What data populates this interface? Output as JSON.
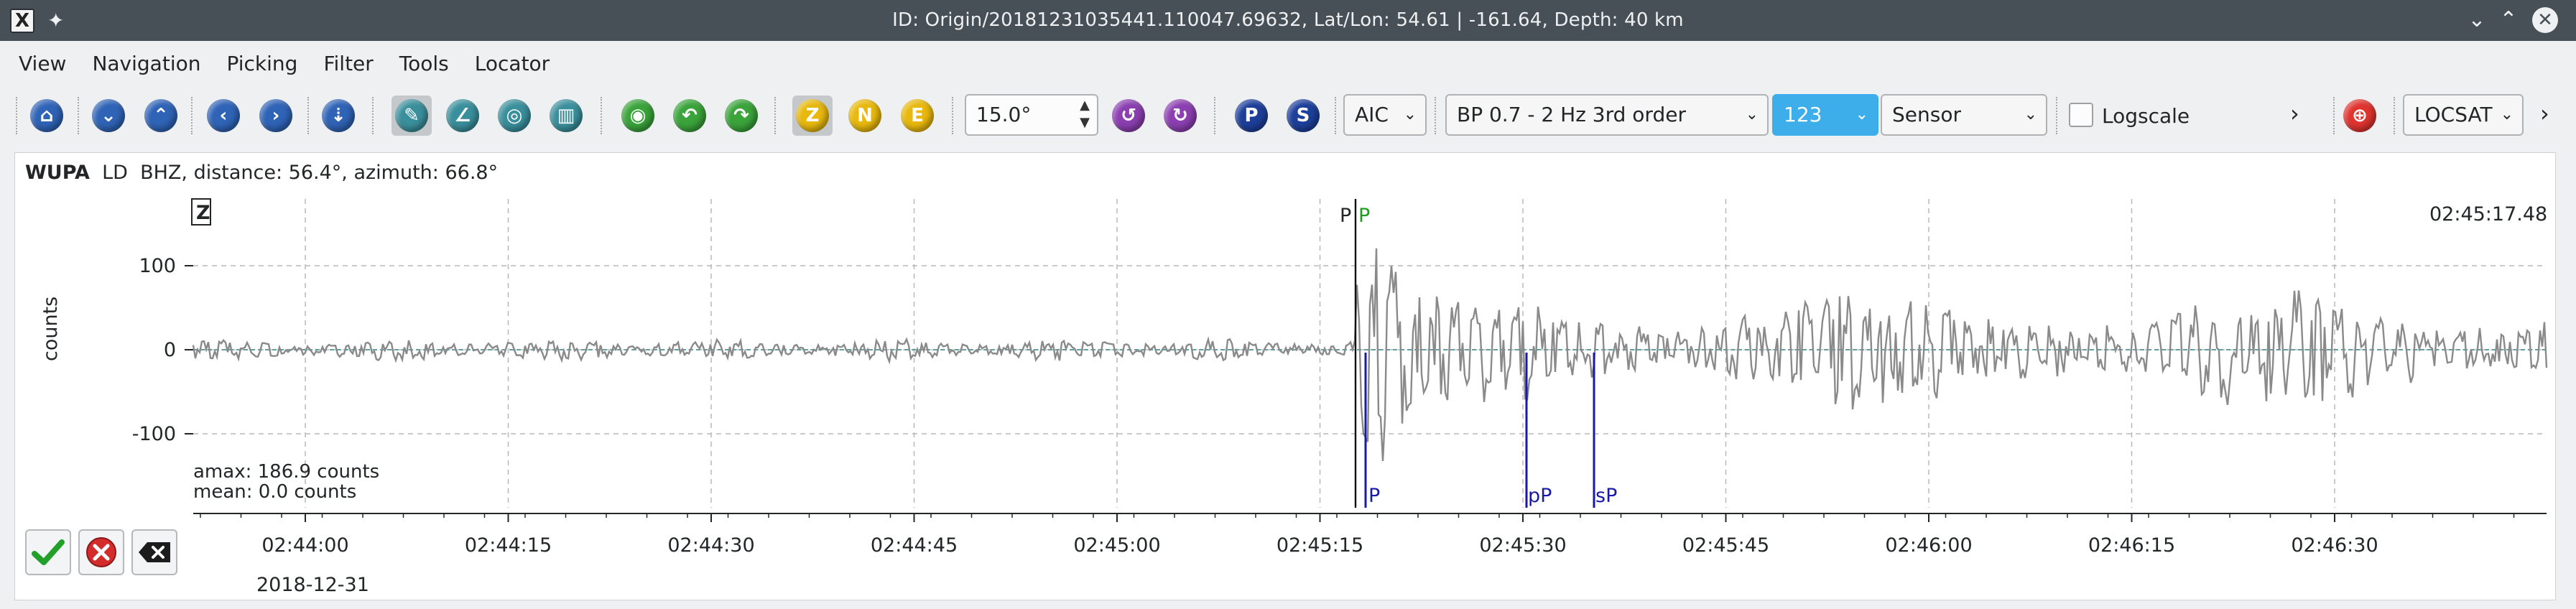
{
  "window": {
    "title": "ID: Origin/20181231035441.110047.69632, Lat/Lon: 54.61 | -161.64, Depth: 40 km",
    "app_icon": "x-app-icon",
    "pin_icon": "pin-icon"
  },
  "menu": {
    "items": [
      "View",
      "Navigation",
      "Picking",
      "Filter",
      "Tools",
      "Locator"
    ]
  },
  "toolbar": {
    "angle_value": "15.0°",
    "picker_method": "AIC",
    "filter": "BP 0.7 - 2 Hz  3rd order",
    "component_mode": "123",
    "unit": "Sensor",
    "logscale_label": "Logscale",
    "logscale_checked": false,
    "locator": "LOCSAT",
    "component_buttons": [
      "Z",
      "N",
      "E"
    ],
    "phase_buttons": [
      "P",
      "S"
    ],
    "colors": {
      "blue_button": "#2f63b6",
      "teal_button": "#3a8f9c",
      "green_button": "#3aa33a",
      "yellow_button": "#e8b80c",
      "purple_button": "#8b3fb0",
      "navy_button": "#1d3f9a",
      "red_target": "#e0342f"
    }
  },
  "trace": {
    "station": "WUPA",
    "network_channel": "LD  BHZ, distance: 56.4°, azimuth: 66.8°",
    "component_tag": "Z",
    "start_timestamp": "02:45:17.48",
    "ylabel": "counts",
    "amax": "amax: 186.9 counts",
    "mean": "mean: 0.0 counts",
    "date": "2018-12-31",
    "y_ticks": [
      "100",
      "0",
      "-100"
    ],
    "x_ticks": [
      "02:44:00",
      "02:44:15",
      "02:44:30",
      "02:44:45",
      "02:45:00",
      "02:45:15",
      "02:45:30",
      "02:45:45",
      "02:46:00",
      "02:46:15",
      "02:46:30"
    ],
    "picks_top": [
      {
        "label": "P",
        "color": "#232627"
      },
      {
        "label": "P",
        "color": "#1e9c1e"
      }
    ],
    "theoretical_phases": [
      {
        "label": "P",
        "color": "#1a1aa6"
      },
      {
        "label": "pP",
        "color": "#1a1aa6"
      },
      {
        "label": "sP",
        "color": "#1a1aa6"
      }
    ],
    "colors": {
      "waveform": "#8a8a8a",
      "zero_line": "#5fa0a0",
      "grid": "#b8b8b8",
      "pick_line": "#111111"
    }
  },
  "actions": {
    "accept_icon": "checkmark-icon",
    "cancel_icon": "cancel-icon",
    "clear_icon": "clear-backspace-icon"
  }
}
